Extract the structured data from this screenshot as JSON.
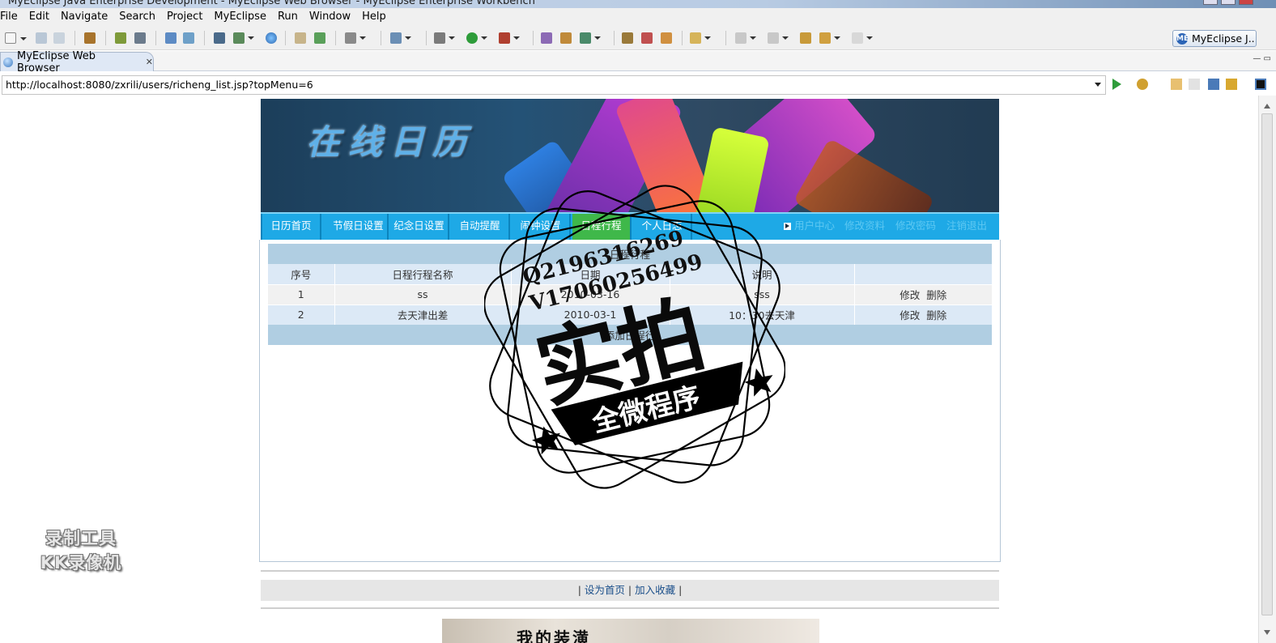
{
  "window": {
    "title": "MyEclipse Java Enterprise Development - MyEclipse Web Browser - MyEclipse Enterprise Workbench"
  },
  "menu": [
    "File",
    "Edit",
    "Navigate",
    "Search",
    "Project",
    "MyEclipse",
    "Run",
    "Window",
    "Help"
  ],
  "perspective": {
    "label": "MyEclipse J...",
    "badge": "ME"
  },
  "tab": {
    "label": "MyEclipse Web Browser",
    "close": "✕"
  },
  "browser": {
    "url": "http://localhost:8080/zxrili/users/richeng_list.jsp?topMenu=6"
  },
  "site": {
    "title": "在线日历",
    "nav": [
      "日历首页",
      "节假日设置",
      "纪念日设置",
      "自动提醒",
      "闹钟设置",
      "日程行程",
      "个人日志"
    ],
    "nav_active": "日程行程",
    "nav_right": [
      "用户中心",
      "修改资料",
      "修改密码",
      "注销退出"
    ]
  },
  "table": {
    "caption": "日程行程",
    "headers": [
      "序号",
      "日程行程名称",
      "日期",
      "说明",
      ""
    ],
    "rows": [
      {
        "no": "1",
        "name": "ss",
        "date": "2010-03-16",
        "note": "sss",
        "edit": "修改",
        "del": "删除"
      },
      {
        "no": "2",
        "name": "去天津出差",
        "date": "2010-03-1",
        "note": "10：30去天津",
        "edit": "修改",
        "del": "删除"
      }
    ],
    "add_label": "添加日程行"
  },
  "footer": {
    "sep_left": "|",
    "set_home": "设为首页",
    "sep_mid": "|",
    "bookmark": "加入收藏",
    "sep_right": "|"
  },
  "bottom_banner": {
    "text": "我的装潢"
  },
  "stamp": {
    "qq": "Q2196316269",
    "phone": "V17060256499",
    "main": "实拍",
    "ribbon": "全微程序"
  },
  "watermark": {
    "line1": "录制工具",
    "line2": "KK录像机"
  },
  "colors": {
    "nav_bg": "#1ea9e6",
    "nav_active": "#3fb84a",
    "table_caption": "#b0cee2",
    "row_alt": "#dce9f6"
  }
}
